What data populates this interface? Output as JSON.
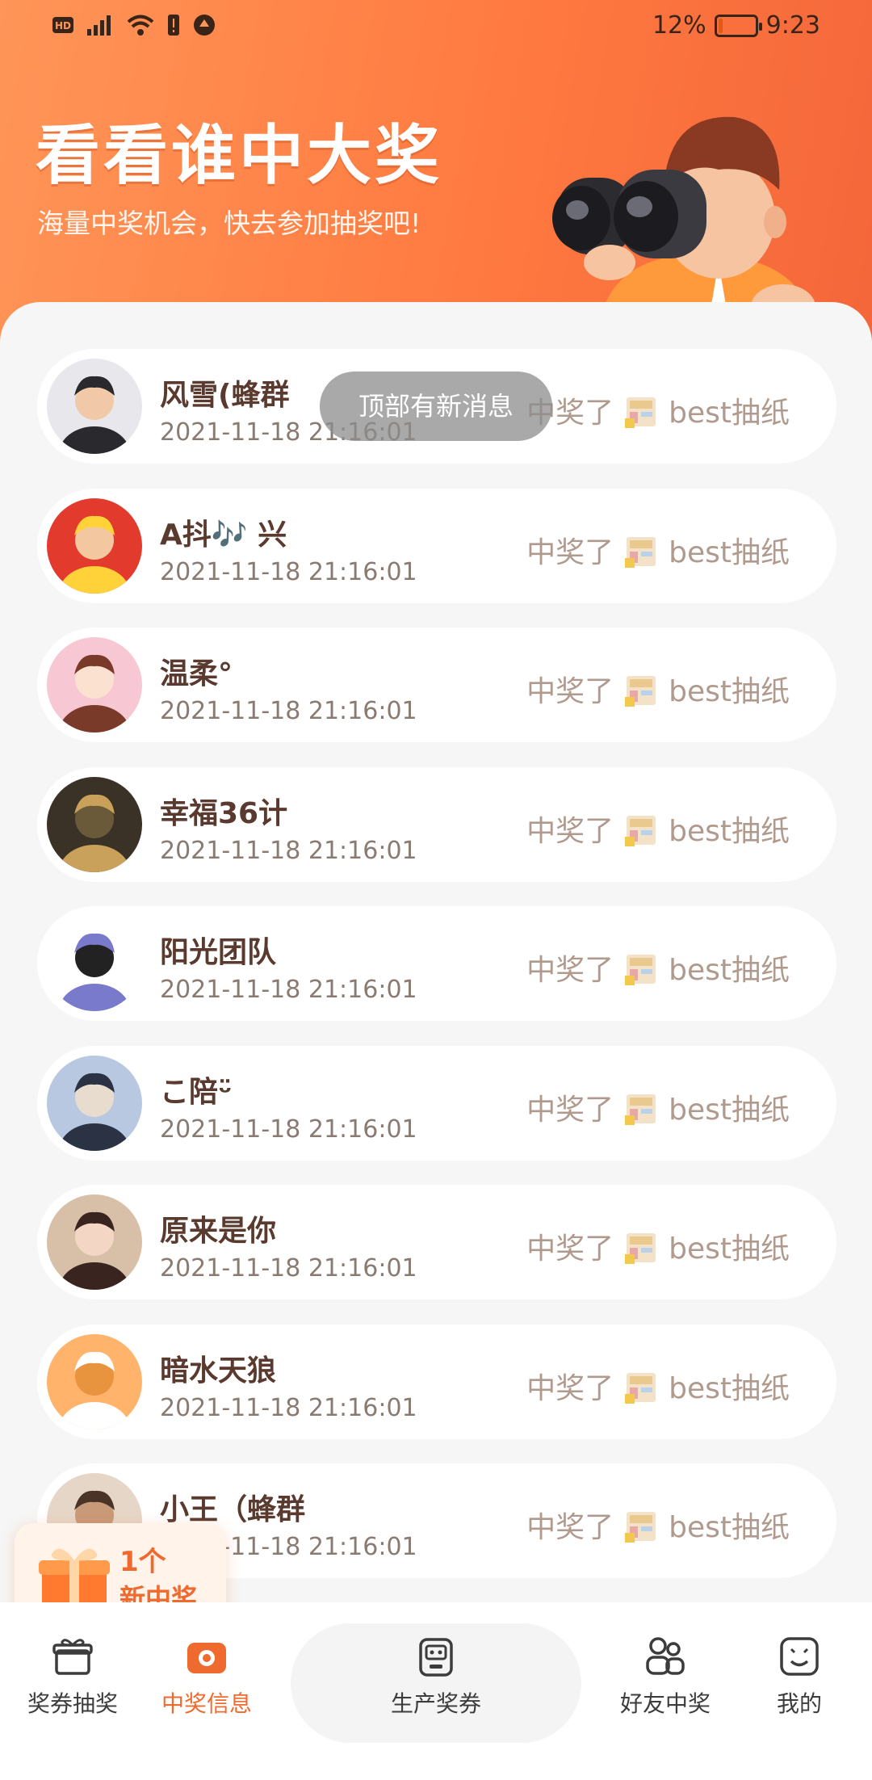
{
  "status_bar": {
    "battery": "12%",
    "time": "9:23",
    "battery_level": 0.12
  },
  "hero": {
    "title": "看看谁中大奖",
    "subtitle": "海量中奖机会，快去参加抽奖吧!"
  },
  "toast": "顶部有新消息",
  "winners": [
    {
      "name": "风雪(蜂群",
      "time": "2021-11-18 21:16:01",
      "won": "中奖了",
      "prize": "best抽纸"
    },
    {
      "name": "A抖🎶 兴",
      "time": "2021-11-18 21:16:01",
      "won": "中奖了",
      "prize": "best抽纸"
    },
    {
      "name": "温柔°",
      "time": "2021-11-18 21:16:01",
      "won": "中奖了",
      "prize": "best抽纸"
    },
    {
      "name": "幸福36计",
      "time": "2021-11-18 21:16:01",
      "won": "中奖了",
      "prize": "best抽纸"
    },
    {
      "name": "阳光团队",
      "time": "2021-11-18 21:16:01",
      "won": "中奖了",
      "prize": "best抽纸"
    },
    {
      "name": "こ陪ᵕ̈",
      "time": "2021-11-18 21:16:01",
      "won": "中奖了",
      "prize": "best抽纸"
    },
    {
      "name": "原来是你",
      "time": "2021-11-18 21:16:01",
      "won": "中奖了",
      "prize": "best抽纸"
    },
    {
      "name": "暗水天狼",
      "time": "2021-11-18 21:16:01",
      "won": "中奖了",
      "prize": "best抽纸"
    },
    {
      "name": "小王（蜂群",
      "time": "2021-11-18 21:16:01",
      "won": "中奖了",
      "prize": "best抽纸"
    }
  ],
  "new_winner_badge": {
    "count": "1个",
    "label": "新中奖"
  },
  "bottom_nav": {
    "items": [
      {
        "label": "奖券抽奖",
        "icon": "gift-icon"
      },
      {
        "label": "中奖信息",
        "icon": "camera-icon",
        "active": true
      },
      {
        "label": "生产奖券",
        "icon": "robot-icon"
      },
      {
        "label": "好友中奖",
        "icon": "friends-icon"
      },
      {
        "label": "我的",
        "icon": "smile-face-icon"
      }
    ]
  },
  "colors": {
    "accent": "#ef6a2e",
    "header_start": "#ff9558",
    "header_end": "#f4663a",
    "name_text": "#5a3a2e"
  }
}
